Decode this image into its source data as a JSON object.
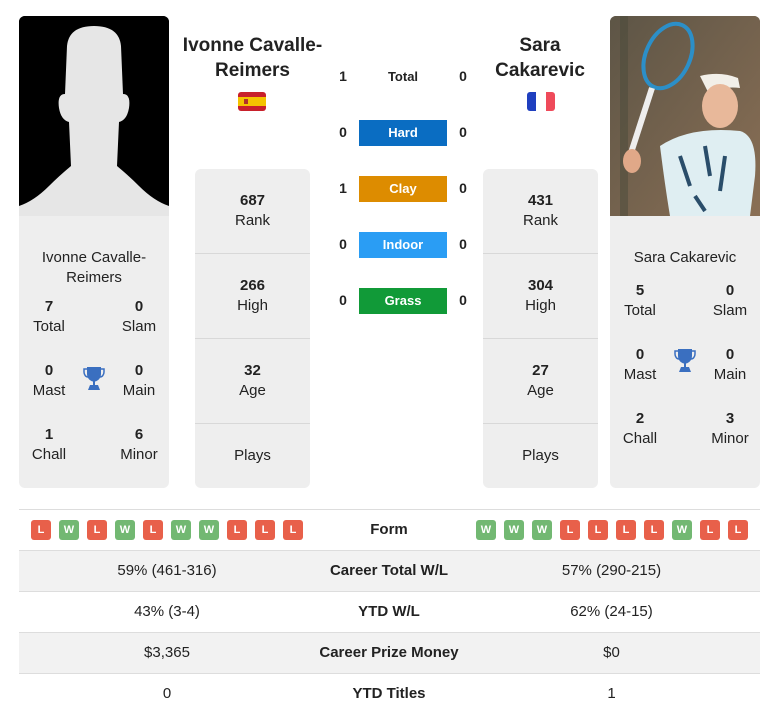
{
  "player1": {
    "name": "Ivonne Cavalle-Reimers",
    "photo_icon": "silhouette-placeholder",
    "flag": "spain",
    "titles": {
      "total": {
        "value": "7",
        "label": "Total"
      },
      "slam": {
        "value": "0",
        "label": "Slam"
      },
      "mast": {
        "value": "0",
        "label": "Mast"
      },
      "main": {
        "value": "0",
        "label": "Main"
      },
      "chall": {
        "value": "1",
        "label": "Chall"
      },
      "minor": {
        "value": "6",
        "label": "Minor"
      }
    },
    "stats": {
      "rank": {
        "value": "687",
        "label": "Rank"
      },
      "high": {
        "value": "266",
        "label": "High"
      },
      "age": {
        "value": "32",
        "label": "Age"
      },
      "plays": {
        "value": "",
        "label": "Plays"
      }
    },
    "form": [
      "L",
      "W",
      "L",
      "W",
      "L",
      "W",
      "W",
      "L",
      "L",
      "L"
    ]
  },
  "player2": {
    "name": "Sara Cakarevic",
    "photo_icon": "player-photo",
    "flag": "france",
    "titles": {
      "total": {
        "value": "5",
        "label": "Total"
      },
      "slam": {
        "value": "0",
        "label": "Slam"
      },
      "mast": {
        "value": "0",
        "label": "Mast"
      },
      "main": {
        "value": "0",
        "label": "Main"
      },
      "chall": {
        "value": "2",
        "label": "Chall"
      },
      "minor": {
        "value": "3",
        "label": "Minor"
      }
    },
    "stats": {
      "rank": {
        "value": "431",
        "label": "Rank"
      },
      "high": {
        "value": "304",
        "label": "High"
      },
      "age": {
        "value": "27",
        "label": "Age"
      },
      "plays": {
        "value": "",
        "label": "Plays"
      }
    },
    "form": [
      "W",
      "W",
      "W",
      "L",
      "L",
      "L",
      "L",
      "W",
      "L",
      "L"
    ]
  },
  "h2h": [
    {
      "label": "Total",
      "p1": "1",
      "p2": "0",
      "color": ""
    },
    {
      "label": "Hard",
      "p1": "0",
      "p2": "0",
      "color": "#0a6dc2"
    },
    {
      "label": "Clay",
      "p1": "1",
      "p2": "0",
      "color": "#dd8c00"
    },
    {
      "label": "Indoor",
      "p1": "0",
      "p2": "0",
      "color": "#2a9df4"
    },
    {
      "label": "Grass",
      "p1": "0",
      "p2": "0",
      "color": "#119a38"
    }
  ],
  "comparison": {
    "form_label": "Form",
    "rows": [
      {
        "label": "Career Total W/L",
        "p1": "59% (461-316)",
        "p2": "57% (290-215)"
      },
      {
        "label": "YTD W/L",
        "p1": "43% (3-4)",
        "p2": "62% (24-15)"
      },
      {
        "label": "Career Prize Money",
        "p1": "$3,365",
        "p2": "$0"
      },
      {
        "label": "YTD Titles",
        "p1": "0",
        "p2": "1"
      }
    ]
  },
  "colors": {
    "win": "#72b872",
    "loss": "#e8604a",
    "trophy": "#3a6fc0",
    "card_bg": "#eeeeee"
  }
}
